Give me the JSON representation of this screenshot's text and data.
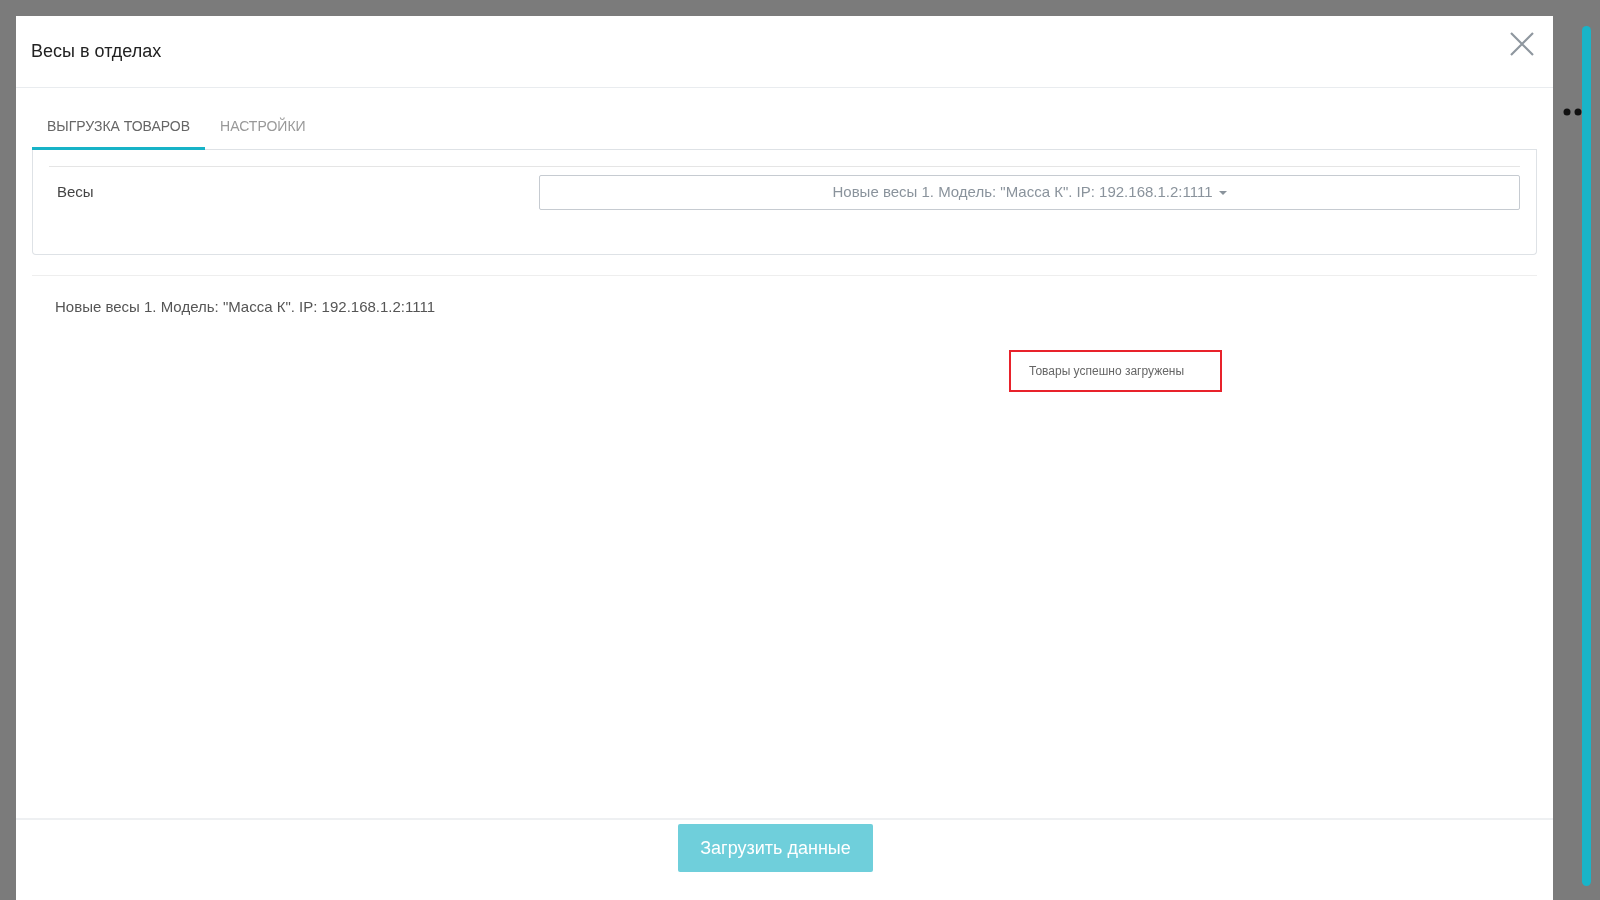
{
  "modal": {
    "title": "Весы в отделах"
  },
  "tabs": [
    {
      "label": "ВЫГРУЗКА ТОВАРОВ",
      "selected": true
    },
    {
      "label": "НАСТРОЙКИ",
      "selected": false
    }
  ],
  "form": {
    "label": "Весы",
    "value": "Новые весы 1. Модель: \"Масса К\". IP: 192.168.1.2:1111"
  },
  "results": [
    {
      "name": "Новые весы 1. Модель: \"Масса К\". IP: 192.168.1.2:1111"
    }
  ],
  "toast": {
    "message": "Товары успешно загружены"
  },
  "footer": {
    "button": "Загрузить данные"
  }
}
